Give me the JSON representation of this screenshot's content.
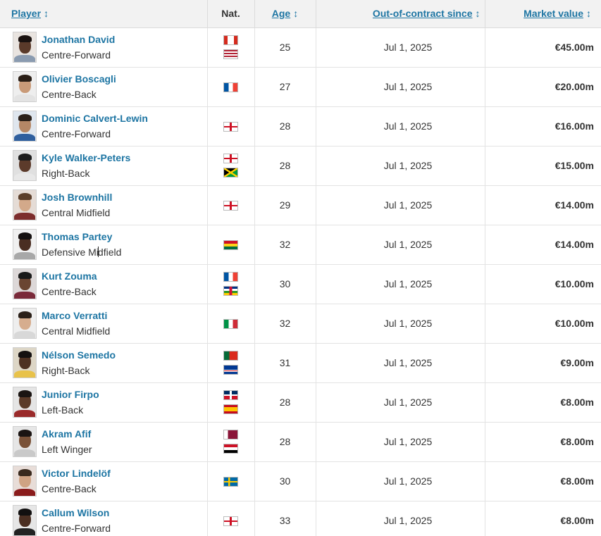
{
  "headers": {
    "player": "Player",
    "nat": "Nat.",
    "age": "Age",
    "ooc": "Out-of-contract since",
    "market_value": "Market value",
    "sort_glyph": "↕"
  },
  "rows": [
    {
      "name": "Jonathan David",
      "position": "Centre-Forward",
      "flags": [
        "canada-flag",
        "usa-flag"
      ],
      "age": "25",
      "ooc": "Jul 1, 2025",
      "value": "€45.00m"
    },
    {
      "name": "Olivier Boscagli",
      "position": "Centre-Back",
      "flags": [
        "france-flag"
      ],
      "age": "27",
      "ooc": "Jul 1, 2025",
      "value": "€20.00m"
    },
    {
      "name": "Dominic Calvert-Lewin",
      "position": "Centre-Forward",
      "flags": [
        "england-flag"
      ],
      "age": "28",
      "ooc": "Jul 1, 2025",
      "value": "€16.00m"
    },
    {
      "name": "Kyle Walker-Peters",
      "position": "Right-Back",
      "flags": [
        "england-flag",
        "jamaica-flag"
      ],
      "age": "28",
      "ooc": "Jul 1, 2025",
      "value": "€15.00m"
    },
    {
      "name": "Josh Brownhill",
      "position": "Central Midfield",
      "flags": [
        "england-flag"
      ],
      "age": "29",
      "ooc": "Jul 1, 2025",
      "value": "€14.00m"
    },
    {
      "name": "Thomas Partey",
      "position_a": "Defensive Mi",
      "position_b": "dfield",
      "flags": [
        "ghana-flag"
      ],
      "age": "32",
      "ooc": "Jul 1, 2025",
      "value": "€14.00m"
    },
    {
      "name": "Kurt Zouma",
      "position": "Centre-Back",
      "flags": [
        "france-flag",
        "central-african-republic-flag"
      ],
      "age": "30",
      "ooc": "Jul 1, 2025",
      "value": "€10.00m"
    },
    {
      "name": "Marco Verratti",
      "position": "Central Midfield",
      "flags": [
        "italy-flag"
      ],
      "age": "32",
      "ooc": "Jul 1, 2025",
      "value": "€10.00m"
    },
    {
      "name": "Nélson Semedo",
      "position": "Right-Back",
      "flags": [
        "portugal-flag",
        "cape-verde-flag"
      ],
      "age": "31",
      "ooc": "Jul 1, 2025",
      "value": "€9.00m"
    },
    {
      "name": "Junior Firpo",
      "position": "Left-Back",
      "flags": [
        "dominican-republic-flag",
        "spain-flag"
      ],
      "age": "28",
      "ooc": "Jul 1, 2025",
      "value": "€8.00m"
    },
    {
      "name": "Akram Afif",
      "position": "Left Winger",
      "flags": [
        "qatar-flag",
        "egypt-flag"
      ],
      "age": "28",
      "ooc": "Jul 1, 2025",
      "value": "€8.00m"
    },
    {
      "name": "Victor Lindelöf",
      "position": "Centre-Back",
      "flags": [
        "sweden-flag"
      ],
      "age": "30",
      "ooc": "Jul 1, 2025",
      "value": "€8.00m"
    },
    {
      "name": "Callum Wilson",
      "position": "Centre-Forward",
      "flags": [
        "england-flag"
      ],
      "age": "33",
      "ooc": "Jul 1, 2025",
      "value": "€8.00m"
    }
  ],
  "colors": {
    "link": "#1d75a3",
    "header_bg": "#f2f2f2"
  }
}
